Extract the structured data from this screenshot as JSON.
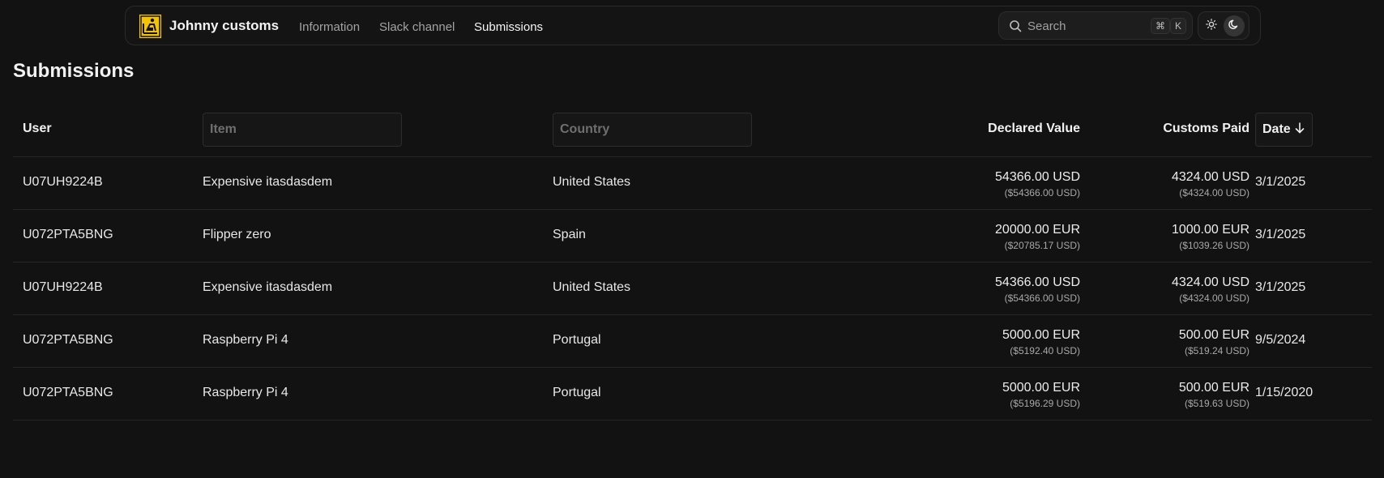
{
  "nav": {
    "brand": "Johnny customs",
    "links": [
      {
        "label": "Information",
        "active": false
      },
      {
        "label": "Slack channel",
        "active": false
      },
      {
        "label": "Submissions",
        "active": true
      }
    ],
    "search": {
      "placeholder": "Search",
      "shortcut": [
        "⌘",
        "K"
      ]
    },
    "theme": {
      "light_icon": "sun-icon",
      "dark_icon": "moon-icon",
      "active": "dark"
    }
  },
  "page": {
    "title": "Submissions"
  },
  "table": {
    "columns": {
      "user": "User",
      "item_placeholder": "Item",
      "country_placeholder": "Country",
      "declared_value": "Declared Value",
      "customs_paid": "Customs Paid",
      "date": "Date",
      "date_sort": "descending"
    },
    "rows": [
      {
        "user": "U07UH9224B",
        "item": "Expensive itasdasdem",
        "country": "United States",
        "declared": "54366.00 USD",
        "declared_usd": "($54366.00 USD)",
        "paid": "4324.00 USD",
        "paid_usd": "($4324.00 USD)",
        "date": "3/1/2025"
      },
      {
        "user": "U072PTA5BNG",
        "item": "Flipper zero",
        "country": "Spain",
        "declared": "20000.00 EUR",
        "declared_usd": "($20785.17 USD)",
        "paid": "1000.00 EUR",
        "paid_usd": "($1039.26 USD)",
        "date": "3/1/2025"
      },
      {
        "user": "U07UH9224B",
        "item": "Expensive itasdasdem",
        "country": "United States",
        "declared": "54366.00 USD",
        "declared_usd": "($54366.00 USD)",
        "paid": "4324.00 USD",
        "paid_usd": "($4324.00 USD)",
        "date": "3/1/2025"
      },
      {
        "user": "U072PTA5BNG",
        "item": "Raspberry Pi 4",
        "country": "Portugal",
        "declared": "5000.00 EUR",
        "declared_usd": "($5192.40 USD)",
        "paid": "500.00 EUR",
        "paid_usd": "($519.24 USD)",
        "date": "9/5/2024"
      },
      {
        "user": "U072PTA5BNG",
        "item": "Raspberry Pi 4",
        "country": "Portugal",
        "declared": "5000.00 EUR",
        "declared_usd": "($5196.29 USD)",
        "paid": "500.00 EUR",
        "paid_usd": "($519.63 USD)",
        "date": "1/15/2020"
      }
    ]
  },
  "colors": {
    "background": "#121212",
    "logo_yellow": "#f5c400"
  }
}
